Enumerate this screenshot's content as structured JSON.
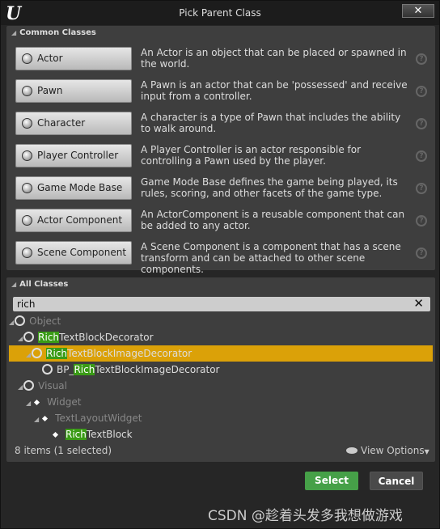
{
  "window": {
    "title": "Pick Parent Class",
    "logo": "U",
    "close_icon": "close-icon"
  },
  "common": {
    "header": "Common Classes",
    "items": [
      {
        "label": "Actor",
        "desc": "An Actor is an object that can be placed or spawned in the world."
      },
      {
        "label": "Pawn",
        "desc": "A Pawn is an actor that can be 'possessed' and receive input from a controller."
      },
      {
        "label": "Character",
        "desc": "A character is a type of Pawn that includes the ability to walk around."
      },
      {
        "label": "Player Controller",
        "desc": "A Player Controller is an actor responsible for controlling a Pawn used by the player."
      },
      {
        "label": "Game Mode Base",
        "desc": "Game Mode Base defines the game being played, its rules, scoring, and other facets of the game type."
      },
      {
        "label": "Actor Component",
        "desc": "An ActorComponent is a reusable component that can be added to any actor."
      },
      {
        "label": "Scene Component",
        "desc": "A Scene Component is a component that has a scene transform and can be attached to other scene components."
      }
    ],
    "help": "?"
  },
  "all": {
    "header": "All Classes",
    "search_value": "rich",
    "clear": "✕",
    "tree": [
      {
        "pre": "",
        "hl": "",
        "post": "Object",
        "dim": true
      },
      {
        "pre": "",
        "hl": "Rich",
        "post": "TextBlockDecorator"
      },
      {
        "pre": "",
        "hl": "Rich",
        "post": "TextBlockImageDecorator",
        "selected": true
      },
      {
        "pre": "BP_",
        "hl": "Rich",
        "post": "TextBlockImageDecorator"
      },
      {
        "pre": "",
        "hl": "",
        "post": "Visual",
        "dim": true
      },
      {
        "pre": "",
        "hl": "",
        "post": "Widget",
        "dim": true
      },
      {
        "pre": "",
        "hl": "",
        "post": "TextLayoutWidget",
        "dim": true
      },
      {
        "pre": "",
        "hl": "Rich",
        "post": "TextBlock"
      }
    ],
    "status": "8 items (1 selected)",
    "view_options": "View Options"
  },
  "colors": {
    "selected": "#dba108",
    "highlight": "#3a9b16",
    "select_button": "#46a048"
  },
  "buttons": {
    "select": "Select",
    "cancel": "Cancel"
  },
  "watermark": "CSDN @趁着头发多我想做游戏"
}
